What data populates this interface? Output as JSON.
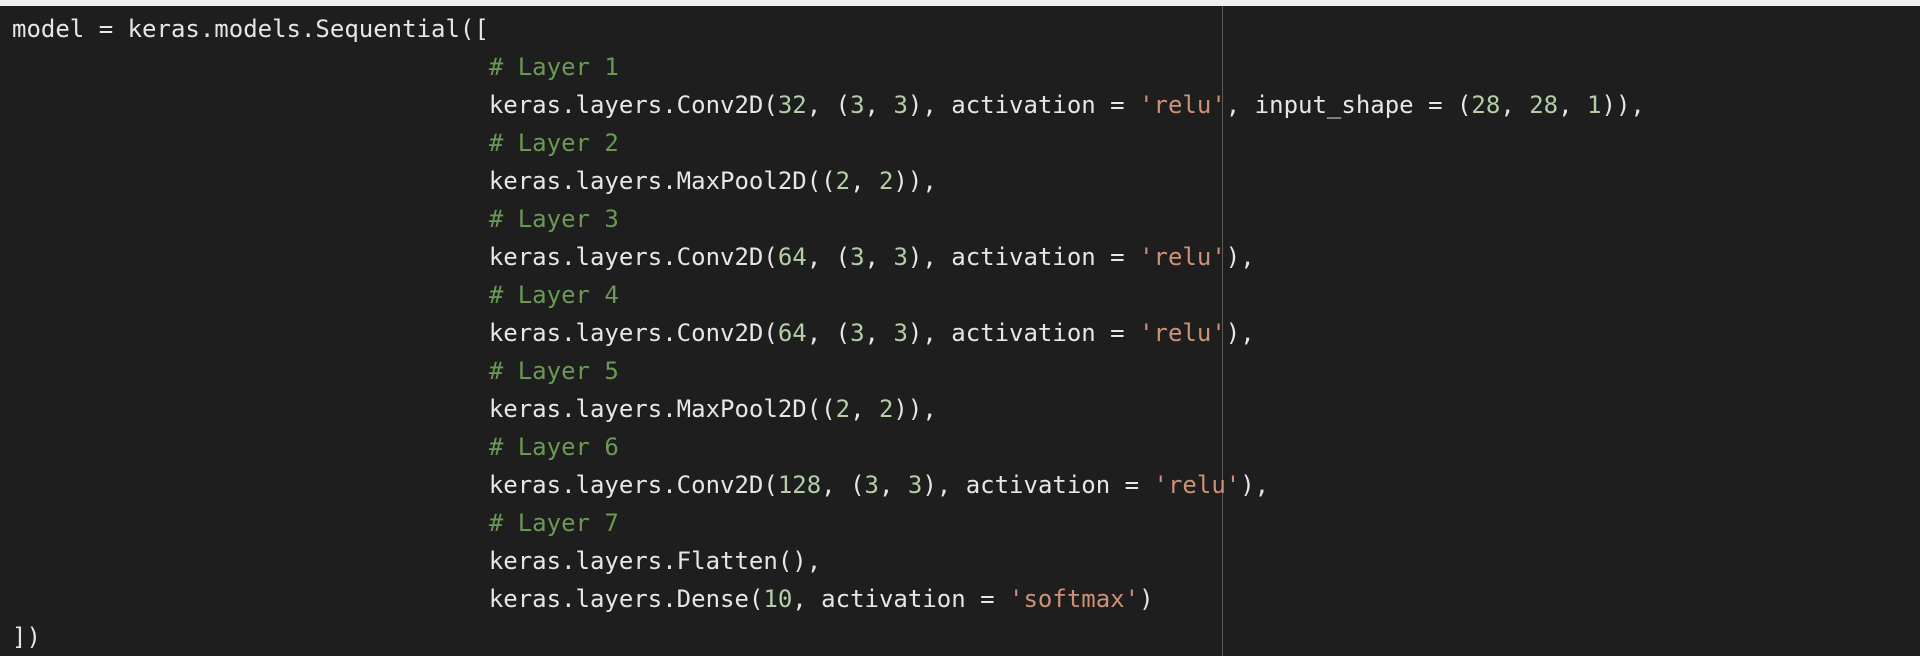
{
  "editor": {
    "ruler_color": "#5a5a5a",
    "background": "#1e1e1e",
    "colors": {
      "plain": "#e6e6e6",
      "number": "#b5cea8",
      "string": "#ce9178",
      "comment": "#6a9955"
    },
    "lines": [
      {
        "indent": "",
        "tokens": [
          {
            "type": "plain",
            "text": "model = keras.models.Sequential(["
          }
        ]
      },
      {
        "indent": "                                 ",
        "tokens": [
          {
            "type": "comment",
            "text": "# Layer 1"
          }
        ]
      },
      {
        "indent": "                                 ",
        "tokens": [
          {
            "type": "plain",
            "text": "keras.layers.Conv2D("
          },
          {
            "type": "num",
            "text": "32"
          },
          {
            "type": "plain",
            "text": ", ("
          },
          {
            "type": "num",
            "text": "3"
          },
          {
            "type": "plain",
            "text": ", "
          },
          {
            "type": "num",
            "text": "3"
          },
          {
            "type": "plain",
            "text": "), activation = "
          },
          {
            "type": "str",
            "text": "'relu'"
          },
          {
            "type": "plain",
            "text": ", input_shape = ("
          },
          {
            "type": "num",
            "text": "28"
          },
          {
            "type": "plain",
            "text": ", "
          },
          {
            "type": "num",
            "text": "28"
          },
          {
            "type": "plain",
            "text": ", "
          },
          {
            "type": "num",
            "text": "1"
          },
          {
            "type": "plain",
            "text": ")),"
          }
        ]
      },
      {
        "indent": "                                 ",
        "tokens": [
          {
            "type": "comment",
            "text": "# Layer 2"
          }
        ]
      },
      {
        "indent": "                                 ",
        "tokens": [
          {
            "type": "plain",
            "text": "keras.layers.MaxPool2D(("
          },
          {
            "type": "num",
            "text": "2"
          },
          {
            "type": "plain",
            "text": ", "
          },
          {
            "type": "num",
            "text": "2"
          },
          {
            "type": "plain",
            "text": ")),"
          }
        ]
      },
      {
        "indent": "                                 ",
        "tokens": [
          {
            "type": "comment",
            "text": "# Layer 3"
          }
        ]
      },
      {
        "indent": "                                 ",
        "tokens": [
          {
            "type": "plain",
            "text": "keras.layers.Conv2D("
          },
          {
            "type": "num",
            "text": "64"
          },
          {
            "type": "plain",
            "text": ", ("
          },
          {
            "type": "num",
            "text": "3"
          },
          {
            "type": "plain",
            "text": ", "
          },
          {
            "type": "num",
            "text": "3"
          },
          {
            "type": "plain",
            "text": "), activation = "
          },
          {
            "type": "str",
            "text": "'relu'"
          },
          {
            "type": "plain",
            "text": "),"
          }
        ]
      },
      {
        "indent": "                                 ",
        "tokens": [
          {
            "type": "comment",
            "text": "# Layer 4"
          }
        ]
      },
      {
        "indent": "                                 ",
        "tokens": [
          {
            "type": "plain",
            "text": "keras.layers.Conv2D("
          },
          {
            "type": "num",
            "text": "64"
          },
          {
            "type": "plain",
            "text": ", ("
          },
          {
            "type": "num",
            "text": "3"
          },
          {
            "type": "plain",
            "text": ", "
          },
          {
            "type": "num",
            "text": "3"
          },
          {
            "type": "plain",
            "text": "), activation = "
          },
          {
            "type": "str",
            "text": "'relu'"
          },
          {
            "type": "plain",
            "text": "),"
          }
        ]
      },
      {
        "indent": "                                 ",
        "tokens": [
          {
            "type": "comment",
            "text": "# Layer 5"
          }
        ]
      },
      {
        "indent": "                                 ",
        "tokens": [
          {
            "type": "plain",
            "text": "keras.layers.MaxPool2D(("
          },
          {
            "type": "num",
            "text": "2"
          },
          {
            "type": "plain",
            "text": ", "
          },
          {
            "type": "num",
            "text": "2"
          },
          {
            "type": "plain",
            "text": ")),"
          }
        ]
      },
      {
        "indent": "                                 ",
        "tokens": [
          {
            "type": "comment",
            "text": "# Layer 6"
          }
        ]
      },
      {
        "indent": "                                 ",
        "tokens": [
          {
            "type": "plain",
            "text": "keras.layers.Conv2D("
          },
          {
            "type": "num",
            "text": "128"
          },
          {
            "type": "plain",
            "text": ", ("
          },
          {
            "type": "num",
            "text": "3"
          },
          {
            "type": "plain",
            "text": ", "
          },
          {
            "type": "num",
            "text": "3"
          },
          {
            "type": "plain",
            "text": "), activation = "
          },
          {
            "type": "str",
            "text": "'relu'"
          },
          {
            "type": "plain",
            "text": "),"
          }
        ]
      },
      {
        "indent": "                                 ",
        "tokens": [
          {
            "type": "comment",
            "text": "# Layer 7"
          }
        ]
      },
      {
        "indent": "                                 ",
        "tokens": [
          {
            "type": "plain",
            "text": "keras.layers.Flatten(),"
          }
        ]
      },
      {
        "indent": "                                 ",
        "tokens": [
          {
            "type": "plain",
            "text": "keras.layers.Dense("
          },
          {
            "type": "num",
            "text": "10"
          },
          {
            "type": "plain",
            "text": ", activation = "
          },
          {
            "type": "str",
            "text": "'softmax'"
          },
          {
            "type": "plain",
            "text": ")"
          }
        ]
      },
      {
        "indent": "",
        "tokens": [
          {
            "type": "plain",
            "text": "])"
          }
        ]
      }
    ]
  }
}
